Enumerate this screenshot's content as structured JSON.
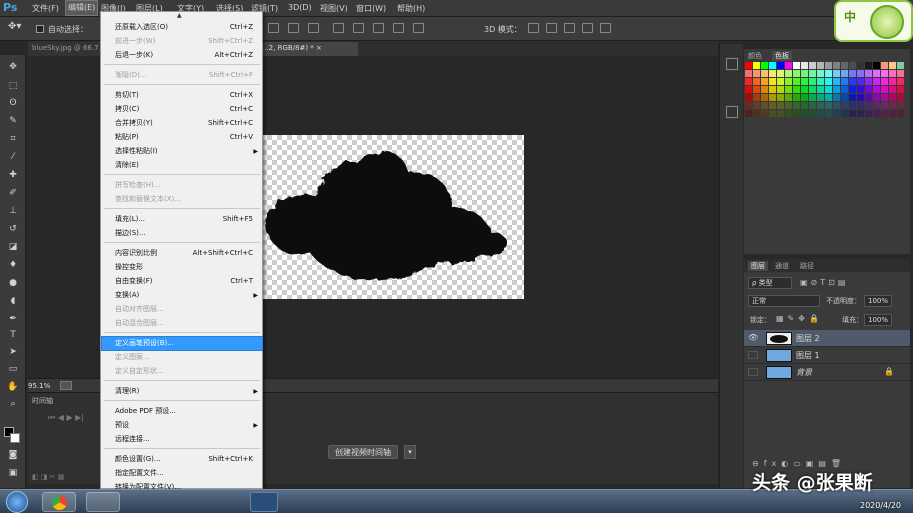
{
  "app": {
    "logo": "Ps"
  },
  "menubar": {
    "items": [
      {
        "label": "文件(F)"
      },
      {
        "label": "编辑(E)"
      },
      {
        "label": "图像(I)"
      },
      {
        "label": "图层(L)"
      },
      {
        "label": "文字(Y)"
      },
      {
        "label": "选择(S)"
      },
      {
        "label": "滤镜(T)"
      },
      {
        "label": "3D(D)"
      },
      {
        "label": "视图(V)"
      },
      {
        "label": "窗口(W)"
      },
      {
        "label": "帮助(H)"
      }
    ]
  },
  "options": {
    "auto_select": "自动选择：",
    "mode_3d": "3D 模式："
  },
  "tabs": [
    {
      "label": "blueSky.jpg @ 66.7..."
    },
    {
      "label": "...2, RGB/8#) * ×"
    }
  ],
  "status": {
    "zoom": "95.1%"
  },
  "timeline": {
    "title": "时间轴",
    "create_button": "创建视频时间轴"
  },
  "edit_menu": {
    "items": [
      {
        "label": "还原载入选区(O)",
        "shortcut": "Ctrl+Z",
        "disabled": false
      },
      {
        "label": "前进一步(W)",
        "shortcut": "Shift+Ctrl+Z",
        "disabled": true
      },
      {
        "label": "后退一步(K)",
        "shortcut": "Alt+Ctrl+Z",
        "disabled": false
      },
      {
        "label": "渐隐(D)...",
        "shortcut": "Shift+Ctrl+F",
        "disabled": true
      },
      {
        "label": "剪切(T)",
        "shortcut": "Ctrl+X",
        "disabled": false
      },
      {
        "label": "拷贝(C)",
        "shortcut": "Ctrl+C",
        "disabled": false
      },
      {
        "label": "合并拷贝(Y)",
        "shortcut": "Shift+Ctrl+C",
        "disabled": false
      },
      {
        "label": "粘贴(P)",
        "shortcut": "Ctrl+V",
        "disabled": false
      },
      {
        "label": "选择性粘贴(I)",
        "shortcut": "",
        "disabled": false,
        "submenu": true
      },
      {
        "label": "清除(E)",
        "shortcut": "",
        "disabled": false
      },
      {
        "label": "拼写检查(H)...",
        "shortcut": "",
        "disabled": true
      },
      {
        "label": "查找和替换文本(X)...",
        "shortcut": "",
        "disabled": true
      },
      {
        "label": "填充(L)...",
        "shortcut": "Shift+F5",
        "disabled": false
      },
      {
        "label": "描边(S)...",
        "shortcut": "",
        "disabled": false
      },
      {
        "label": "内容识别比例",
        "shortcut": "Alt+Shift+Ctrl+C",
        "disabled": false
      },
      {
        "label": "操控变形",
        "shortcut": "",
        "disabled": false
      },
      {
        "label": "自由变换(F)",
        "shortcut": "Ctrl+T",
        "disabled": false
      },
      {
        "label": "变换(A)",
        "shortcut": "",
        "disabled": false,
        "submenu": true
      },
      {
        "label": "自动对齐图层...",
        "shortcut": "",
        "disabled": true
      },
      {
        "label": "自动混合图层...",
        "shortcut": "",
        "disabled": true
      },
      {
        "label": "定义画笔预设(B)...",
        "shortcut": "",
        "disabled": false,
        "highlighted": true
      },
      {
        "label": "定义图案...",
        "shortcut": "",
        "disabled": true
      },
      {
        "label": "定义自定形状...",
        "shortcut": "",
        "disabled": true
      },
      {
        "label": "清理(R)",
        "shortcut": "",
        "disabled": false,
        "submenu": true
      },
      {
        "label": "Adobe PDF 预设...",
        "shortcut": "",
        "disabled": false
      },
      {
        "label": "预设",
        "shortcut": "",
        "disabled": false,
        "submenu": true
      },
      {
        "label": "远程连接...",
        "shortcut": "",
        "disabled": false
      },
      {
        "label": "颜色设置(G)...",
        "shortcut": "Shift+Ctrl+K",
        "disabled": false
      },
      {
        "label": "指定配置文件...",
        "shortcut": "",
        "disabled": false
      },
      {
        "label": "转换为配置文件(V)...",
        "shortcut": "",
        "disabled": false
      }
    ]
  },
  "swatches_panel": {
    "tabs": [
      "颜色",
      "色板"
    ]
  },
  "layers_panel": {
    "tabs": [
      "图层",
      "通道",
      "路径"
    ],
    "filter": "ρ 类型",
    "blend_mode": "正常",
    "opacity_label": "不透明度：",
    "opacity": "100%",
    "lock_label": "锁定：",
    "fill_label": "填充：",
    "fill": "100%",
    "layers": [
      {
        "name": "图层 2",
        "selected": true,
        "visible": true
      },
      {
        "name": "图层 1",
        "selected": false,
        "visible": false
      },
      {
        "name": "背景",
        "selected": false,
        "visible": false,
        "locked": true
      }
    ]
  },
  "watermark": {
    "text": "头条 @张果断",
    "date": "2020/4/20"
  },
  "colors": {
    "accent": "#3399ff",
    "panel": "#3a3a3a",
    "menu_bg": "#f0f0f0"
  }
}
